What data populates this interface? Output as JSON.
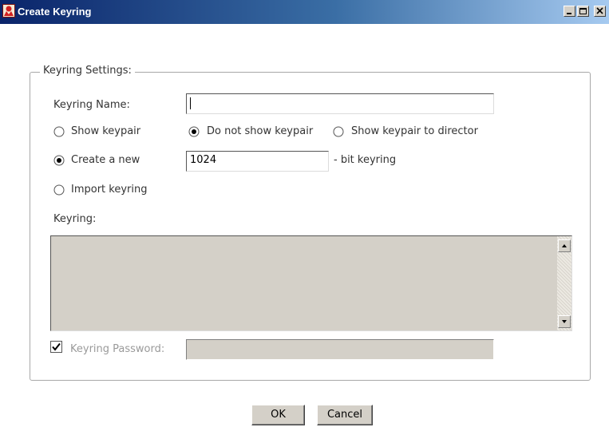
{
  "window": {
    "title": "Create Keyring",
    "controls": {
      "minimize": "minimize-icon",
      "maximize": "maximize-icon",
      "close": "close-icon"
    }
  },
  "group": {
    "legend": "Keyring Settings:"
  },
  "fields": {
    "keyring_name_label": "Keyring Name:",
    "keyring_name_value": "",
    "bits_value": "1024",
    "bits_suffix": "- bit keyring",
    "keyring_label": "Keyring:",
    "keyring_value": "",
    "password_label": "Keyring Password:",
    "password_value": ""
  },
  "options": {
    "show_keypair": {
      "label": "Show keypair",
      "selected": false
    },
    "do_not_show_keypair": {
      "label": "Do not show keypair",
      "selected": true
    },
    "show_keypair_director": {
      "label": "Show keypair to director",
      "selected": false
    },
    "create_new": {
      "label": "Create a new",
      "selected": true
    },
    "import_keyring": {
      "label": "Import keyring",
      "selected": false
    }
  },
  "password_checkbox": {
    "checked": true,
    "enabled": false
  },
  "buttons": {
    "ok": "OK",
    "cancel": "Cancel"
  },
  "colors": {
    "titlebar_start": "#0a246a",
    "titlebar_end": "#a6caf0",
    "panel": "#d4d0c8",
    "group_border": "#a8a8a8"
  }
}
